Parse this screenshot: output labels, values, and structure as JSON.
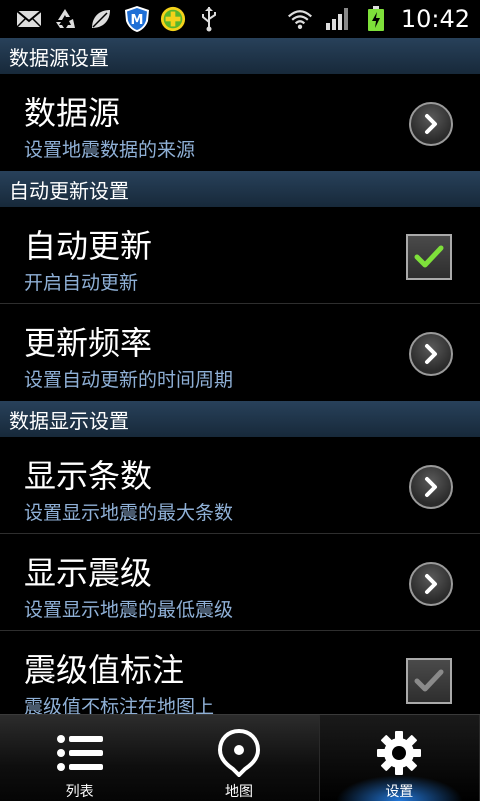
{
  "status_bar": {
    "time": "10:42",
    "icons_left": [
      "mail-icon",
      "recycle-icon",
      "leaf-icon",
      "m-shield-icon",
      "plus-badge-icon",
      "usb-icon"
    ],
    "icons_right": [
      "wifi-icon",
      "signal-icon",
      "battery-charging-icon"
    ]
  },
  "sections": [
    {
      "header": "数据源设置",
      "rows": [
        {
          "title": "数据源",
          "subtitle": "设置地震数据的来源",
          "control": "chevron"
        }
      ]
    },
    {
      "header": "自动更新设置",
      "rows": [
        {
          "title": "自动更新",
          "subtitle": "开启自动更新",
          "control": "checkbox",
          "checked": true
        },
        {
          "title": "更新频率",
          "subtitle": "设置自动更新的时间周期",
          "control": "chevron"
        }
      ]
    },
    {
      "header": "数据显示设置",
      "rows": [
        {
          "title": "显示条数",
          "subtitle": "设置显示地震的最大条数",
          "control": "chevron"
        },
        {
          "title": "显示震级",
          "subtitle": "设置显示地震的最低震级",
          "control": "chevron"
        },
        {
          "title": "震级值标注",
          "subtitle": "震级值不标注在地图上",
          "control": "checkbox",
          "checked": false
        }
      ]
    }
  ],
  "tabs": [
    {
      "label": "列表",
      "icon": "list-icon",
      "active": false
    },
    {
      "label": "地图",
      "icon": "map-pin-icon",
      "active": false
    },
    {
      "label": "设置",
      "icon": "gear-icon",
      "active": true
    }
  ],
  "colors": {
    "section_header": "#1d3347",
    "subtitle": "#8fb0d6",
    "check_green": "#7ee03a",
    "active_glow": "#288cff"
  }
}
